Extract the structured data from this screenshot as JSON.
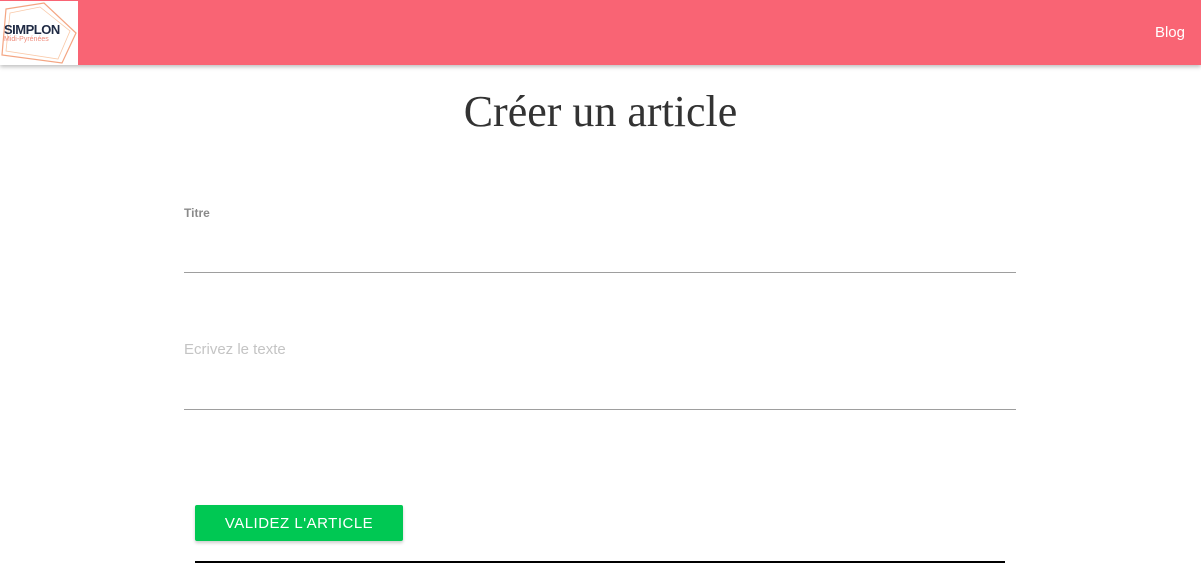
{
  "navbar": {
    "background_color": "#f96474",
    "logo": {
      "main_text": "SIMPLON",
      "sub_text": "Midi-Pyrénées",
      "outline_color": "#f4a582"
    },
    "links": [
      {
        "label": "Blog"
      }
    ]
  },
  "main": {
    "title": "Créer un article",
    "form": {
      "title_field": {
        "label": "Titre",
        "value": "",
        "placeholder": ""
      },
      "text_field": {
        "value": "",
        "placeholder": "Ecrivez le texte"
      },
      "submit": {
        "label": "VALIDEZ L'ARTICLE",
        "color": "#00c853"
      }
    }
  }
}
